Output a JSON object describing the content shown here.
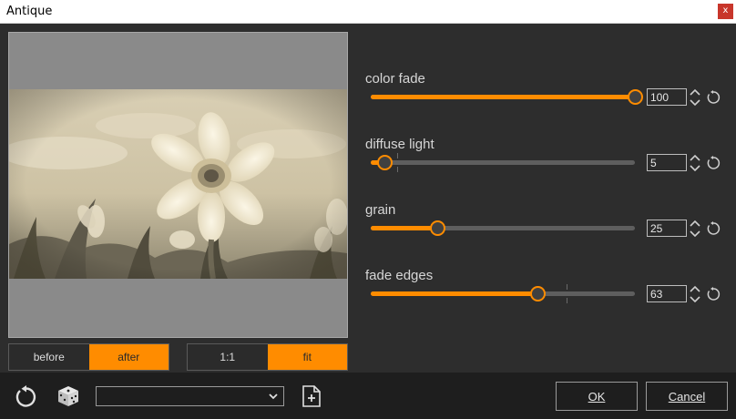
{
  "window": {
    "title": "Antique",
    "close_glyph": "x"
  },
  "view_toggle": {
    "before": "before",
    "after": "after",
    "active": "after"
  },
  "zoom_toggle": {
    "one_to_one": "1:1",
    "fit": "fit",
    "active": "fit"
  },
  "params": [
    {
      "label": "color fade",
      "value": "100",
      "fraction": 1.0,
      "default_fraction": null
    },
    {
      "label": "diffuse light",
      "value": "5",
      "fraction": 0.05,
      "default_fraction": 0.1
    },
    {
      "label": "grain",
      "value": "25",
      "fraction": 0.25,
      "default_fraction": null
    },
    {
      "label": "fade edges",
      "value": "63",
      "fraction": 0.63,
      "default_fraction": 0.74
    }
  ],
  "bottom": {
    "preset_value": "",
    "ok_label": "OK",
    "cancel_label": "Cancel"
  },
  "icons": [
    "reset-all-icon",
    "random-dice-icon",
    "chevron-down-icon",
    "new-preset-icon",
    "spin-updown-icon",
    "reset-param-icon"
  ],
  "colors": {
    "accent": "#ff8c00",
    "panel": "#2d2d2d",
    "bottom": "#1e1e1e",
    "close": "#c8362b",
    "sepia_light": "#efe7d1",
    "sepia_dark": "#5b5647"
  }
}
